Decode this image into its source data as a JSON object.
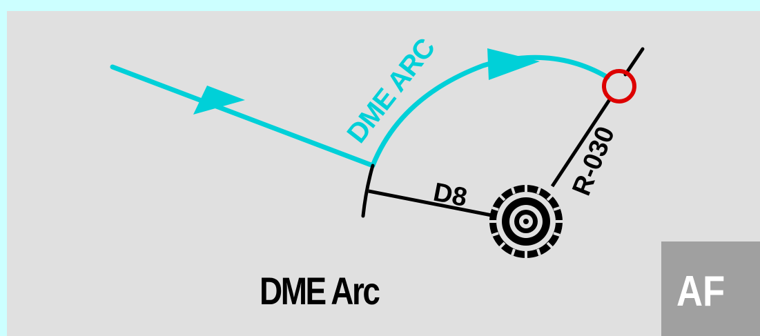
{
  "diagram": {
    "arc_label": "DME ARC",
    "distance_label": "D8",
    "radial_label": "R-030",
    "caption": "DME Arc",
    "badge": "AF"
  },
  "colors": {
    "background_outer": "#ccffff",
    "panel": "#e0e0e0",
    "course": "#00d0d8",
    "fix": "#dd0000",
    "ink": "#000000",
    "badge": "#a0a0a0"
  },
  "icons": {
    "navaid": "vortac-icon",
    "fix": "fix-circle-icon",
    "arrow": "direction-arrow-icon"
  }
}
